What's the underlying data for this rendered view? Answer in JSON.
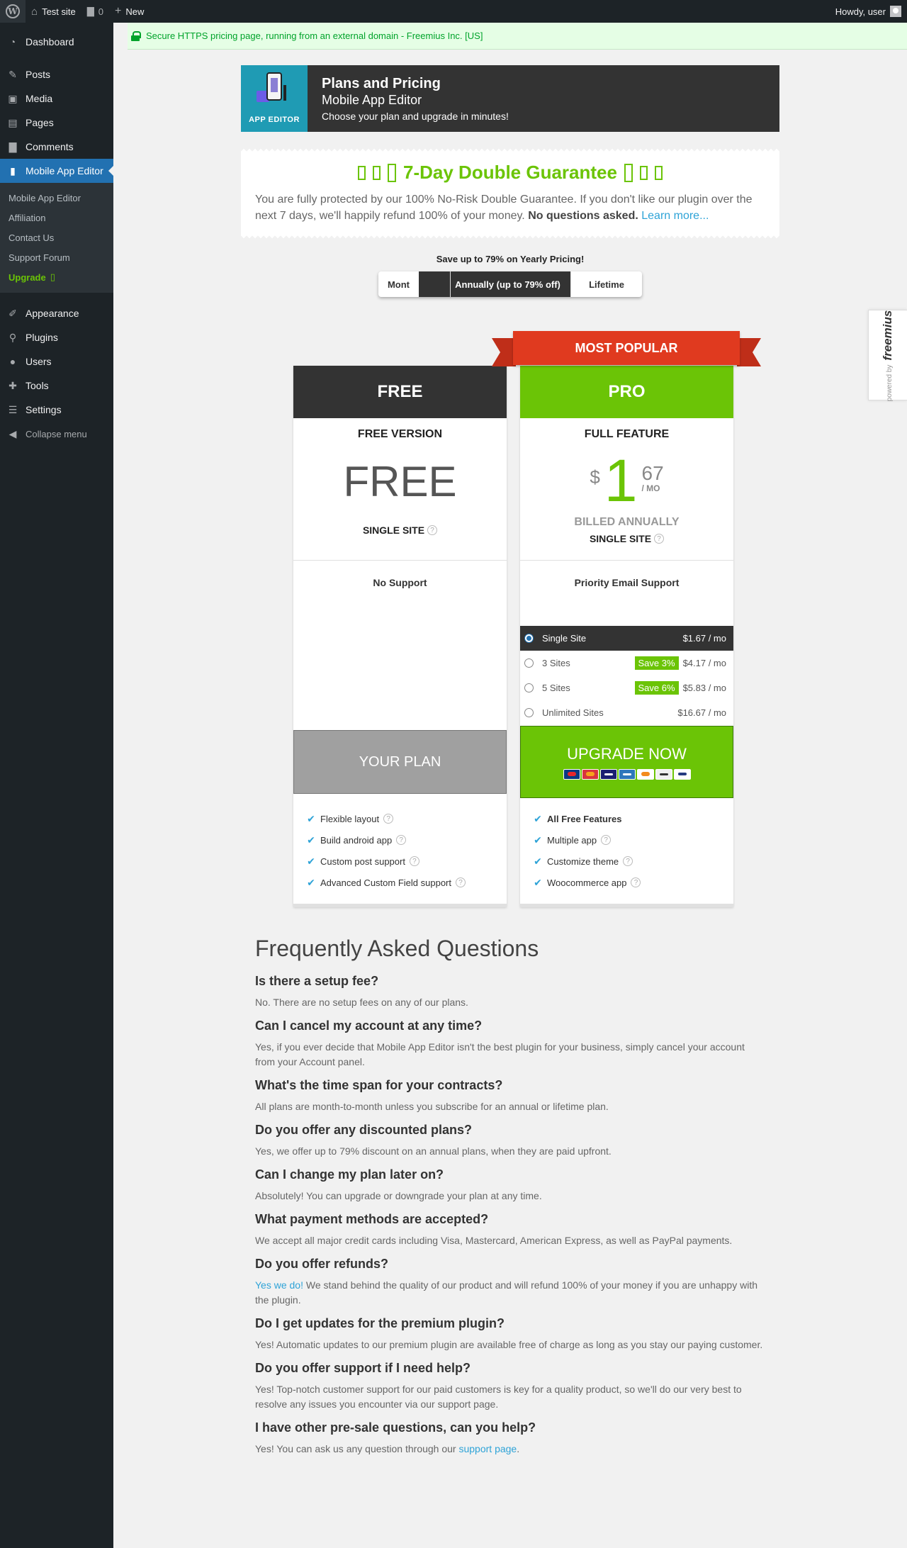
{
  "adminbar": {
    "site_name": "Test site",
    "comments_count": "0",
    "new_label": "New",
    "howdy": "Howdy, user"
  },
  "sidebar": {
    "items": [
      {
        "label": "Dashboard",
        "icon": "gauge-icon"
      },
      {
        "label": "Posts",
        "icon": "pin-icon"
      },
      {
        "label": "Media",
        "icon": "media-icon"
      },
      {
        "label": "Pages",
        "icon": "page-icon"
      },
      {
        "label": "Comments",
        "icon": "comment-icon"
      },
      {
        "label": "Mobile App Editor",
        "icon": "phone-icon"
      }
    ],
    "submenu": [
      {
        "label": "Mobile App Editor"
      },
      {
        "label": "Affiliation"
      },
      {
        "label": "Contact Us"
      },
      {
        "label": "Support Forum"
      },
      {
        "label": "Upgrade",
        "glyph": "▯"
      }
    ],
    "items2": [
      {
        "label": "Appearance",
        "icon": "brush-icon"
      },
      {
        "label": "Plugins",
        "icon": "plug-icon"
      },
      {
        "label": "Users",
        "icon": "user-icon"
      },
      {
        "label": "Tools",
        "icon": "wrench-icon"
      },
      {
        "label": "Settings",
        "icon": "sliders-icon"
      }
    ],
    "collapse_label": "Collapse menu"
  },
  "notice": {
    "text": "Secure HTTPS pricing page, running from an external domain - Freemius Inc. [US]"
  },
  "freemius_tab": {
    "powered_by": "powered by",
    "brand": "freemius"
  },
  "header": {
    "logo_text": "APP EDITOR",
    "title": "Plans and Pricing",
    "subtitle": "Mobile App Editor",
    "tagline": "Choose your plan and upgrade in minutes!"
  },
  "guarantee": {
    "title": "7-Day Double Guarantee",
    "text": "You are fully protected by our 100% No-Risk Double Guarantee. If you don't like our plugin over the next 7 days, we'll happily refund 100% of your money. ",
    "bold": "No questions asked.",
    "link": "Learn more..."
  },
  "billing": {
    "save_text": "Save up to 79% on Yearly Pricing!",
    "monthly": "Mont",
    "annual": "Annually (up to 79% off)",
    "lifetime": "Lifetime"
  },
  "ribbon": "MOST POPULAR",
  "plans": {
    "free": {
      "title": "FREE",
      "description": "FREE VERSION",
      "price": "FREE",
      "site_label": "SINGLE SITE",
      "support": "No Support",
      "button": "YOUR PLAN",
      "features": [
        "Flexible layout",
        "Build android app",
        "Custom post support",
        "Advanced Custom Field support"
      ]
    },
    "pro": {
      "title": "PRO",
      "description": "FULL FEATURE",
      "currency": "$",
      "price_int": "1",
      "price_frac": "67",
      "per": "/ MO",
      "billed": "BILLED ANNUALLY",
      "site_label": "SINGLE SITE",
      "support": "Priority Email Support",
      "licenses": [
        {
          "label": "Single Site",
          "save": "",
          "price": "$1.67 / mo"
        },
        {
          "label": "3 Sites",
          "save": "Save 3%",
          "price": "$4.17 / mo"
        },
        {
          "label": "5 Sites",
          "save": "Save 6%",
          "price": "$5.83 / mo"
        },
        {
          "label": "Unlimited Sites",
          "save": "",
          "price": "$16.67 / mo"
        }
      ],
      "button": "UPGRADE NOW",
      "features": [
        "All Free Features",
        "Multiple app",
        "Customize theme",
        "Woocommerce app"
      ]
    }
  },
  "faq": {
    "title": "Frequently Asked Questions",
    "items": [
      {
        "q": "Is there a setup fee?",
        "a": "No. There are no setup fees on any of our plans."
      },
      {
        "q": "Can I cancel my account at any time?",
        "a": "Yes, if you ever decide that Mobile App Editor isn't the best plugin for your business, simply cancel your account from your Account panel."
      },
      {
        "q": "What's the time span for your contracts?",
        "a": "All plans are month-to-month unless you subscribe for an annual or lifetime plan."
      },
      {
        "q": "Do you offer any discounted plans?",
        "a": "Yes, we offer up to 79% discount on an annual plans, when they are paid upfront."
      },
      {
        "q": "Can I change my plan later on?",
        "a": "Absolutely! You can upgrade or downgrade your plan at any time."
      },
      {
        "q": "What payment methods are accepted?",
        "a": "We accept all major credit cards including Visa, Mastercard, American Express, as well as PayPal payments."
      },
      {
        "q": "Do you offer refunds?",
        "link": "Yes we do!",
        "a": " We stand behind the quality of our product and will refund 100% of your money if you are unhappy with the plugin."
      },
      {
        "q": "Do I get updates for the premium plugin?",
        "a": "Yes! Automatic updates to our premium plugin are available free of charge as long as you stay our paying customer."
      },
      {
        "q": "Do you offer support if I need help?",
        "a": "Yes! Top-notch customer support for our paid customers is key for a quality product, so we'll do our very best to resolve any issues you encounter via our support page."
      },
      {
        "q": "I have other pre-sale questions, can you help?",
        "a": "Yes! You can ask us any question through our ",
        "link2": "support page",
        "tail": "."
      }
    ]
  }
}
